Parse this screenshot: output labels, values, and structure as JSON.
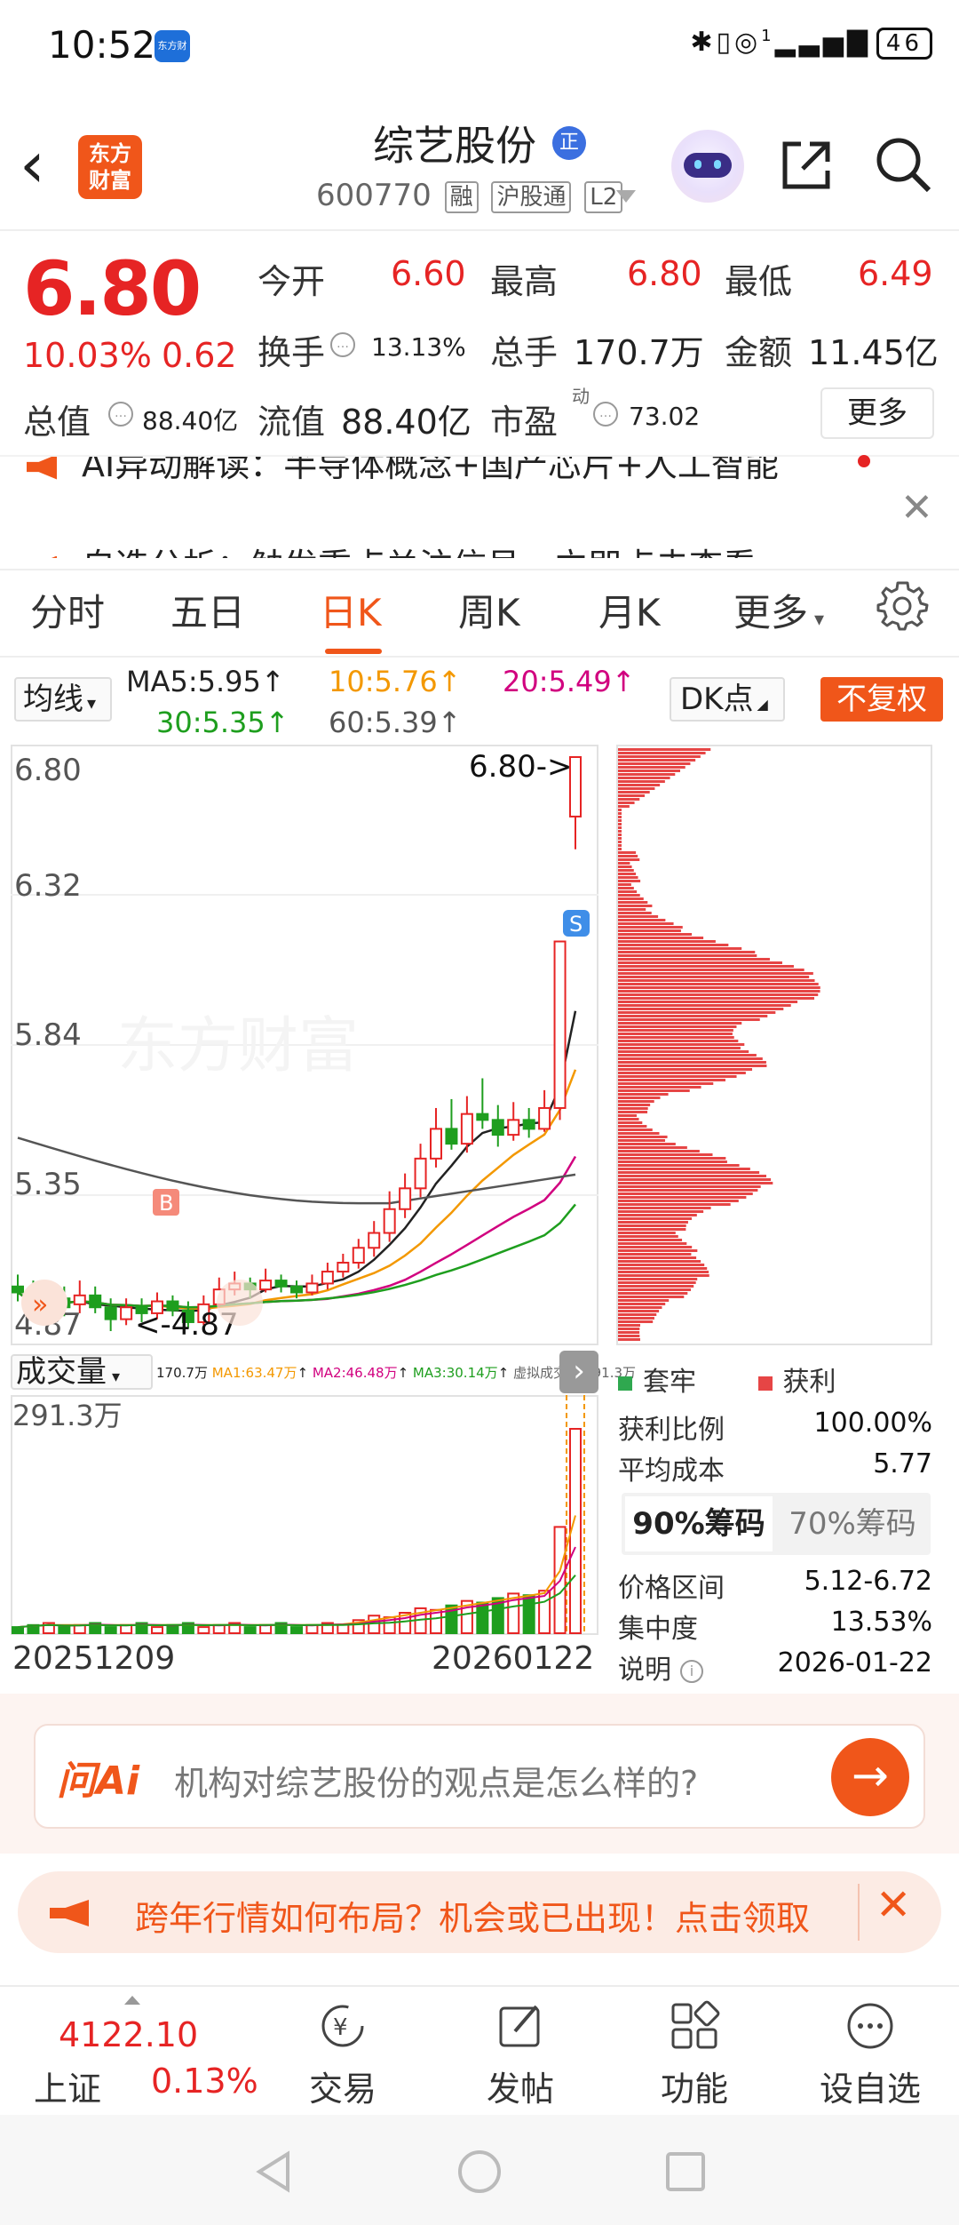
{
  "status_bar": {
    "time": "10:52",
    "app_badge": "东方财富",
    "network": "1",
    "battery": "46"
  },
  "header": {
    "back_icon": "chevron-left",
    "logo": "东方\n财富",
    "title": "综艺股份",
    "title_badge": "正",
    "code": "600770",
    "tags": [
      "融",
      "沪股通",
      "L2"
    ]
  },
  "quote": {
    "price": "6.80",
    "change_pct": "10.03%",
    "change": "0.62",
    "fields": [
      {
        "label": "今开",
        "value": "6.60",
        "color": "red"
      },
      {
        "label": "最高",
        "value": "6.80",
        "color": "red"
      },
      {
        "label": "最低",
        "value": "6.49",
        "color": "red"
      },
      {
        "label": "换手",
        "value": "13.13%",
        "color": "dark"
      },
      {
        "label": "总手",
        "value": "170.7万",
        "color": "dark"
      },
      {
        "label": "金额",
        "value": "11.45亿",
        "color": "dark"
      },
      {
        "label": "总值",
        "value": "88.40亿",
        "color": "dark"
      },
      {
        "label": "流值",
        "value": "88.40亿",
        "color": "dark"
      },
      {
        "label": "市盈",
        "value": "73.02",
        "color": "dark"
      }
    ],
    "pe_superscript": "动",
    "more_label": "更多"
  },
  "news": [
    "AI异动解读：半导体概念+国产芯片+人工智能",
    "自选分析：触发重点关注信号，立即点击查看"
  ],
  "tabs": [
    {
      "label": "分时"
    },
    {
      "label": "五日"
    },
    {
      "label": "日K",
      "active": true
    },
    {
      "label": "周K"
    },
    {
      "label": "月K"
    },
    {
      "label": "更多"
    }
  ],
  "indicators": {
    "avg_label": "均线",
    "ma5": "MA5:5.95",
    "ma10": "10:5.76",
    "ma20": "20:5.49",
    "ma30": "30:5.35",
    "ma60": "60:5.39",
    "dk_label": "DK点",
    "adjust_label": "不复权",
    "colors": {
      "ma5": "#222222",
      "ma10": "#f39800",
      "ma20": "#d1007f",
      "ma30": "#1e9e1e",
      "ma60": "#555555"
    }
  },
  "kline": {
    "y_labels": [
      "6.80",
      "6.32",
      "5.84",
      "5.35",
      "4.87"
    ],
    "last_price_tag": "6.80->",
    "low_tag": "<-4.87",
    "buy_marker": "B",
    "sell_marker": "S",
    "watermark": "东方财富"
  },
  "volume": {
    "label": "成交量",
    "summary": [
      "170.7万",
      "MA1:63.47万",
      "MA2:46.48万",
      "MA3:30.14万",
      "虚拟成交量:291.3万"
    ],
    "summary_colors": [
      "#222222",
      "#f39800",
      "#d1007f",
      "#1e9e1e",
      "#666666"
    ],
    "max_label": "291.3万"
  },
  "dates": {
    "start": "20251209",
    "end": "20260122"
  },
  "chip_panel": {
    "legend": [
      {
        "label": "套牢",
        "color": "#2fa84f"
      },
      {
        "label": "获利",
        "color": "#e64545"
      }
    ],
    "rows": [
      {
        "label": "获利比例",
        "value": "100.00%"
      },
      {
        "label": "平均成本",
        "value": "5.77"
      }
    ],
    "seg": [
      "90%筹码",
      "70%筹码"
    ],
    "rows2": [
      {
        "label": "价格区间",
        "value": "5.12-6.72"
      },
      {
        "label": "集中度",
        "value": "13.53%"
      },
      {
        "label": "说明",
        "value": "2026-01-22"
      }
    ]
  },
  "ai_bar": {
    "logo": "问Ai",
    "question": "机构对综艺股份的观点是怎么样的?"
  },
  "promo": {
    "text": "跨年行情如何布局？机会或已出现！点击领取"
  },
  "bottom_nav": {
    "index_value": "4122.10",
    "index_name": "上证",
    "index_pct": "0.13%",
    "items": [
      {
        "label": "交易",
        "icon": "trade-icon"
      },
      {
        "label": "发帖",
        "icon": "post-icon"
      },
      {
        "label": "功能",
        "icon": "apps-icon"
      },
      {
        "label": "设自选",
        "icon": "more-icon"
      }
    ]
  }
}
